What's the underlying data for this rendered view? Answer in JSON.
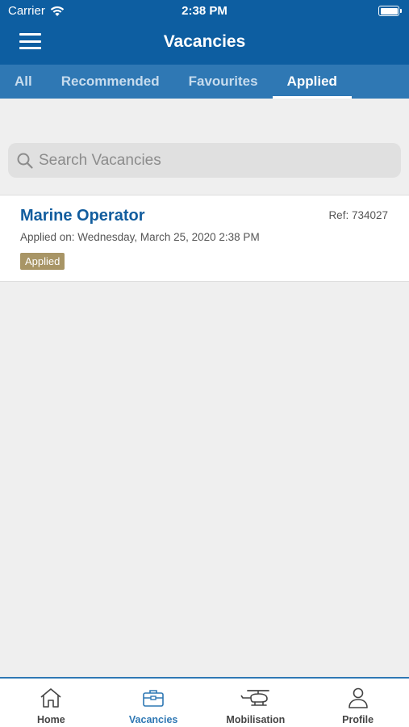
{
  "status_bar": {
    "carrier": "Carrier",
    "time": "2:38 PM"
  },
  "header": {
    "title": "Vacancies"
  },
  "tabs": [
    {
      "label": "All",
      "active": false
    },
    {
      "label": "Recommended",
      "active": false
    },
    {
      "label": "Favourites",
      "active": false
    },
    {
      "label": "Applied",
      "active": true
    }
  ],
  "search": {
    "placeholder": "Search Vacancies",
    "value": ""
  },
  "vacancies": [
    {
      "title": "Marine Operator",
      "ref": "Ref: 734027",
      "applied_on": "Applied on: Wednesday, March 25, 2020 2:38 PM",
      "status": "Applied"
    }
  ],
  "bottom_nav": [
    {
      "label": "Home",
      "icon": "home-icon",
      "active": false
    },
    {
      "label": "Vacancies",
      "icon": "briefcase-icon",
      "active": true
    },
    {
      "label": "Mobilisation",
      "icon": "helicopter-icon",
      "active": false
    },
    {
      "label": "Profile",
      "icon": "person-icon",
      "active": false
    }
  ],
  "colors": {
    "primary": "#0d5ea1",
    "tab_bar": "#2f78b4",
    "status_badge": "#a89566",
    "title_text": "#125d9e"
  }
}
